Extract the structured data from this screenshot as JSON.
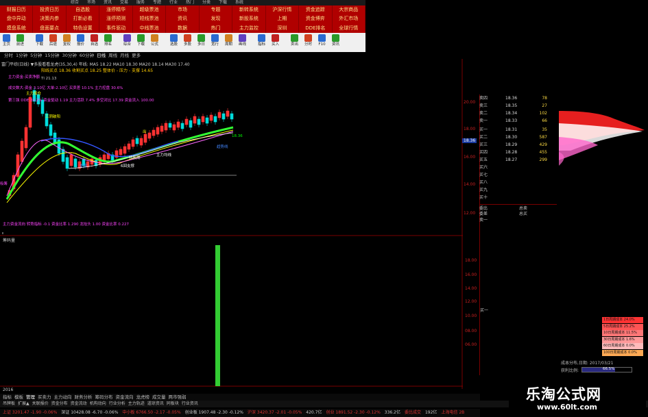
{
  "top_menu": [
    "综合",
    "市场",
    "资讯",
    "交易",
    "服务",
    "专题",
    "行业",
    "热门",
    "分类",
    "下载",
    "系统"
  ],
  "menu_grid": [
    "财报日历",
    "投资日历",
    "自选股",
    "涨停精华",
    "超级票池",
    "市场",
    "专题",
    "新转系统",
    "沪深行情",
    "资金追踪",
    "大宗商品",
    "盘中异动",
    "决策内参",
    "打新必看",
    "涨停预测",
    "短线票池",
    "资讯",
    "发现",
    "新股系统",
    "上期",
    "资金博弈",
    "外汇市场",
    "摸盘系统",
    "盘面要点",
    "特色设置",
    "事件驱动",
    "中线票池",
    "数据",
    "热门",
    "主力监控",
    "深圳",
    "DDE排名",
    "全球行情"
  ],
  "toolbar": [
    "主页",
    "前进",
    "下载",
    "后退",
    "复权",
    "报价",
    "自选",
    "排名",
    "综合",
    "下载",
    "公式",
    "选股",
    "多股",
    "多日",
    "宽行",
    "周期",
    "画线",
    "指标",
    "买入",
    "卖出",
    "分时",
    "F10",
    "资讯"
  ],
  "period_bar": [
    "分时",
    "1分钟",
    "5分钟",
    "15分钟",
    "30分钟",
    "60分钟",
    "日线",
    "周线",
    "月线",
    "更多"
  ],
  "chart": {
    "info_line1": "富门平综(日线)  ▼多股看看龙虎(35,30,4)  年线:   MA5 18.22   MA10 18.30   MA20 18.14   MA30 17.40",
    "info_line2": "阳线买点 18.36 收割买点 18.25  整体价 - 压力 - 支撑 14.65",
    "annotations": [
      {
        "text": "主力资金-买卖净额",
        "color": "#ff44ff"
      },
      {
        "text": "成交数大-资金 3.10亿 大单-2.10亿 买卖差 10.1% 主力控盘 30.6%",
        "color": "#ff44ff"
      },
      {
        "text": "第三强 DDE 24.2% 资金驱动 1.19 主力活跃 7.4% 多空对比 17.39 资金流入 100.00",
        "color": "#ff44ff"
      },
      {
        "text": "三阴破阳",
        "color": "#ffff00"
      },
      {
        "text": "Tl 21.13",
        "color": "#cccccc"
      },
      {
        "text": "主力加仓",
        "color": "#ffff00"
      },
      {
        "text": "出",
        "color": "#ffff00"
      },
      {
        "text": "6回支撑",
        "color": "#ffffff"
      },
      {
        "text": "持股期",
        "color": "#ffffff"
      },
      {
        "text": "支撑",
        "color": "#4488ff"
      },
      {
        "text": "主力均线",
        "color": "#ffffff"
      },
      {
        "text": "趋势线",
        "color": "#4488ff"
      },
      {
        "text": "18.36",
        "color": "#00ff00"
      },
      {
        "text": "吸筹",
        "color": "#ff44ff"
      },
      {
        "text": "主力资金流向  转势指标 -0.1  资金比率 1.290  龙抬头 1.00 资金比率 0.227",
        "color": "#ff44ff"
      }
    ],
    "volume_title": "筹码量",
    "price_ticks": [
      "20.00",
      "18.00",
      "16.00",
      "14.00",
      "12.00"
    ],
    "vol_ticks": [
      "18.00",
      "16.00",
      "14.00",
      "12.00",
      "10.00",
      "08.00",
      "06.00"
    ],
    "current_price_tag": "18.36",
    "bottom_date": "2016"
  },
  "orderbook": {
    "asks": [
      {
        "label": "卖四",
        "price": "18.36",
        "vol": "78"
      },
      {
        "label": "卖三",
        "price": "18.35",
        "vol": "27"
      },
      {
        "label": "卖二",
        "price": "18.34",
        "vol": "102"
      },
      {
        "label": "卖一",
        "price": "18.33",
        "vol": "66"
      }
    ],
    "bids": [
      {
        "label": "买一",
        "price": "18.31",
        "vol": "35"
      },
      {
        "label": "买二",
        "price": "18.30",
        "vol": "587"
      },
      {
        "label": "买三",
        "price": "18.29",
        "vol": "429"
      },
      {
        "label": "买四",
        "price": "18.28",
        "vol": "455"
      },
      {
        "label": "买五",
        "price": "18.27",
        "vol": "299"
      }
    ],
    "extra_levels": [
      "买六",
      "买七",
      "买八",
      "买九",
      "买十"
    ],
    "summary": [
      {
        "label": "委比",
        "value": "总卖"
      },
      {
        "label": "委差",
        "value": "总买"
      },
      {
        "label": "卖一",
        "value": ""
      }
    ],
    "vol_side_label": "买一"
  },
  "cost_legend": [
    {
      "text": "1日周期成本 24.0%",
      "color": "#ff3333"
    },
    {
      "text": "5日周期成本 25.2%",
      "color": "#ff5555"
    },
    {
      "text": "10日周期成本 11.5%",
      "color": "#ff7777"
    },
    {
      "text": "30日周期成本 1.6%",
      "color": "#ff9999"
    },
    {
      "text": "60日周期成本 0.0%",
      "color": "#ffbbbb"
    },
    {
      "text": "100日周期成本 0.0%",
      "color": "#ffaa55"
    }
  ],
  "cost_box": {
    "label": "成本分布,日期: 2017/03/21",
    "ratio_label": "获利比例:",
    "ratio_value": "66.5%"
  },
  "bottom_tabs": [
    "指标",
    "模板",
    "管理",
    "买卖力",
    "主力动向",
    "财务分析",
    "筹码分布",
    "资金流向",
    "龙虎榜",
    "成交量",
    "两市强弱"
  ],
  "bottom_tabs2": [
    "吊牌板",
    "扩展▲",
    "关联报价",
    "资金分布",
    "资金流动",
    "机构动向",
    "行业分析",
    "主力轨迹",
    "道琼资讯",
    "同板块",
    "行业资讯"
  ],
  "status_items": [
    "上证 3201.47 -1.90 -0.06%",
    "深证 10428.08 -6.70 -0.06%",
    "中小板 6766.50 -2.17 -0.05%",
    "创业板 1907.48 -2.30 -0.12%",
    "沪深 3420.37 -2.01 -0.05%",
    "420.7亿",
    "创业 1891.52 -2.30 -0.12%",
    "336.2亿",
    "委比成交",
    "192亿",
    "上海电信 2B"
  ],
  "watermark": {
    "title": "乐淘公式网",
    "url": "www.60lt.com"
  }
}
